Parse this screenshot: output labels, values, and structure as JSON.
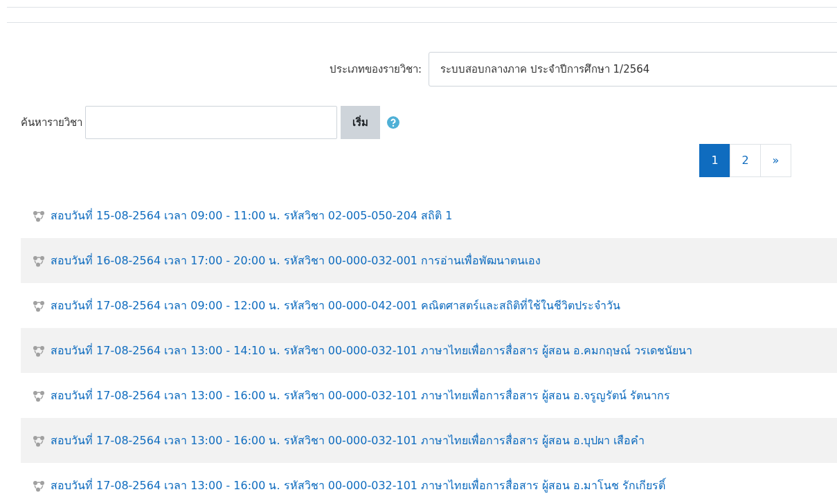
{
  "category": {
    "label": "ประเภทของรายวิชา:",
    "value": "ระบบสอบกลางภาค ประจำปีการศึกษา 1/2564"
  },
  "search": {
    "label": "ค้นหารายวิชา",
    "button": "เริ่ม"
  },
  "pagination": [
    {
      "label": "1",
      "selected": true
    },
    {
      "label": "2",
      "selected": false
    },
    {
      "label": "»",
      "selected": false
    }
  ],
  "courses": [
    {
      "title": "สอบวันที่ 15-08-2564 เวลา 09:00 - 11:00 น. รหัสวิชา 02-005-050-204 สถิติ 1"
    },
    {
      "title": "สอบวันที่ 16-08-2564 เวลา 17:00 - 20:00 น. รหัสวิชา 00-000-032-001 การอ่านเพื่อพัฒนาตนเอง"
    },
    {
      "title": "สอบวันที่ 17-08-2564 เวลา 09:00 - 12:00 น. รหัสวิชา 00-000-042-001 คณิตศาสตร์และสถิติที่ใช้ในชีวิตประจำวัน"
    },
    {
      "title": "สอบวันที่ 17-08-2564 เวลา 13:00 - 14:10 น. รหัสวิชา 00-000-032-101 ภาษาไทยเพื่อการสื่อสาร ผู้สอน อ.คมกฤษณ์ วรเดชนัยนา"
    },
    {
      "title": "สอบวันที่ 17-08-2564 เวลา 13:00 - 16:00 น. รหัสวิชา 00-000-032-101 ภาษาไทยเพื่อการสื่อสาร ผู้สอน อ.จรูญรัตน์ รัตนากร"
    },
    {
      "title": "สอบวันที่ 17-08-2564 เวลา 13:00 - 16:00 น. รหัสวิชา 00-000-032-101 ภาษาไทยเพื่อการสื่อสาร ผู้สอน อ.บุปผา เสือคำ"
    },
    {
      "title": "สอบวันที่ 17-08-2564 เวลา 13:00 - 16:00 น. รหัสวิชา 00-000-032-101 ภาษาไทยเพื่อการสื่อสาร ผู้สอน อ.มาโนช รักเกียรติ์"
    }
  ]
}
